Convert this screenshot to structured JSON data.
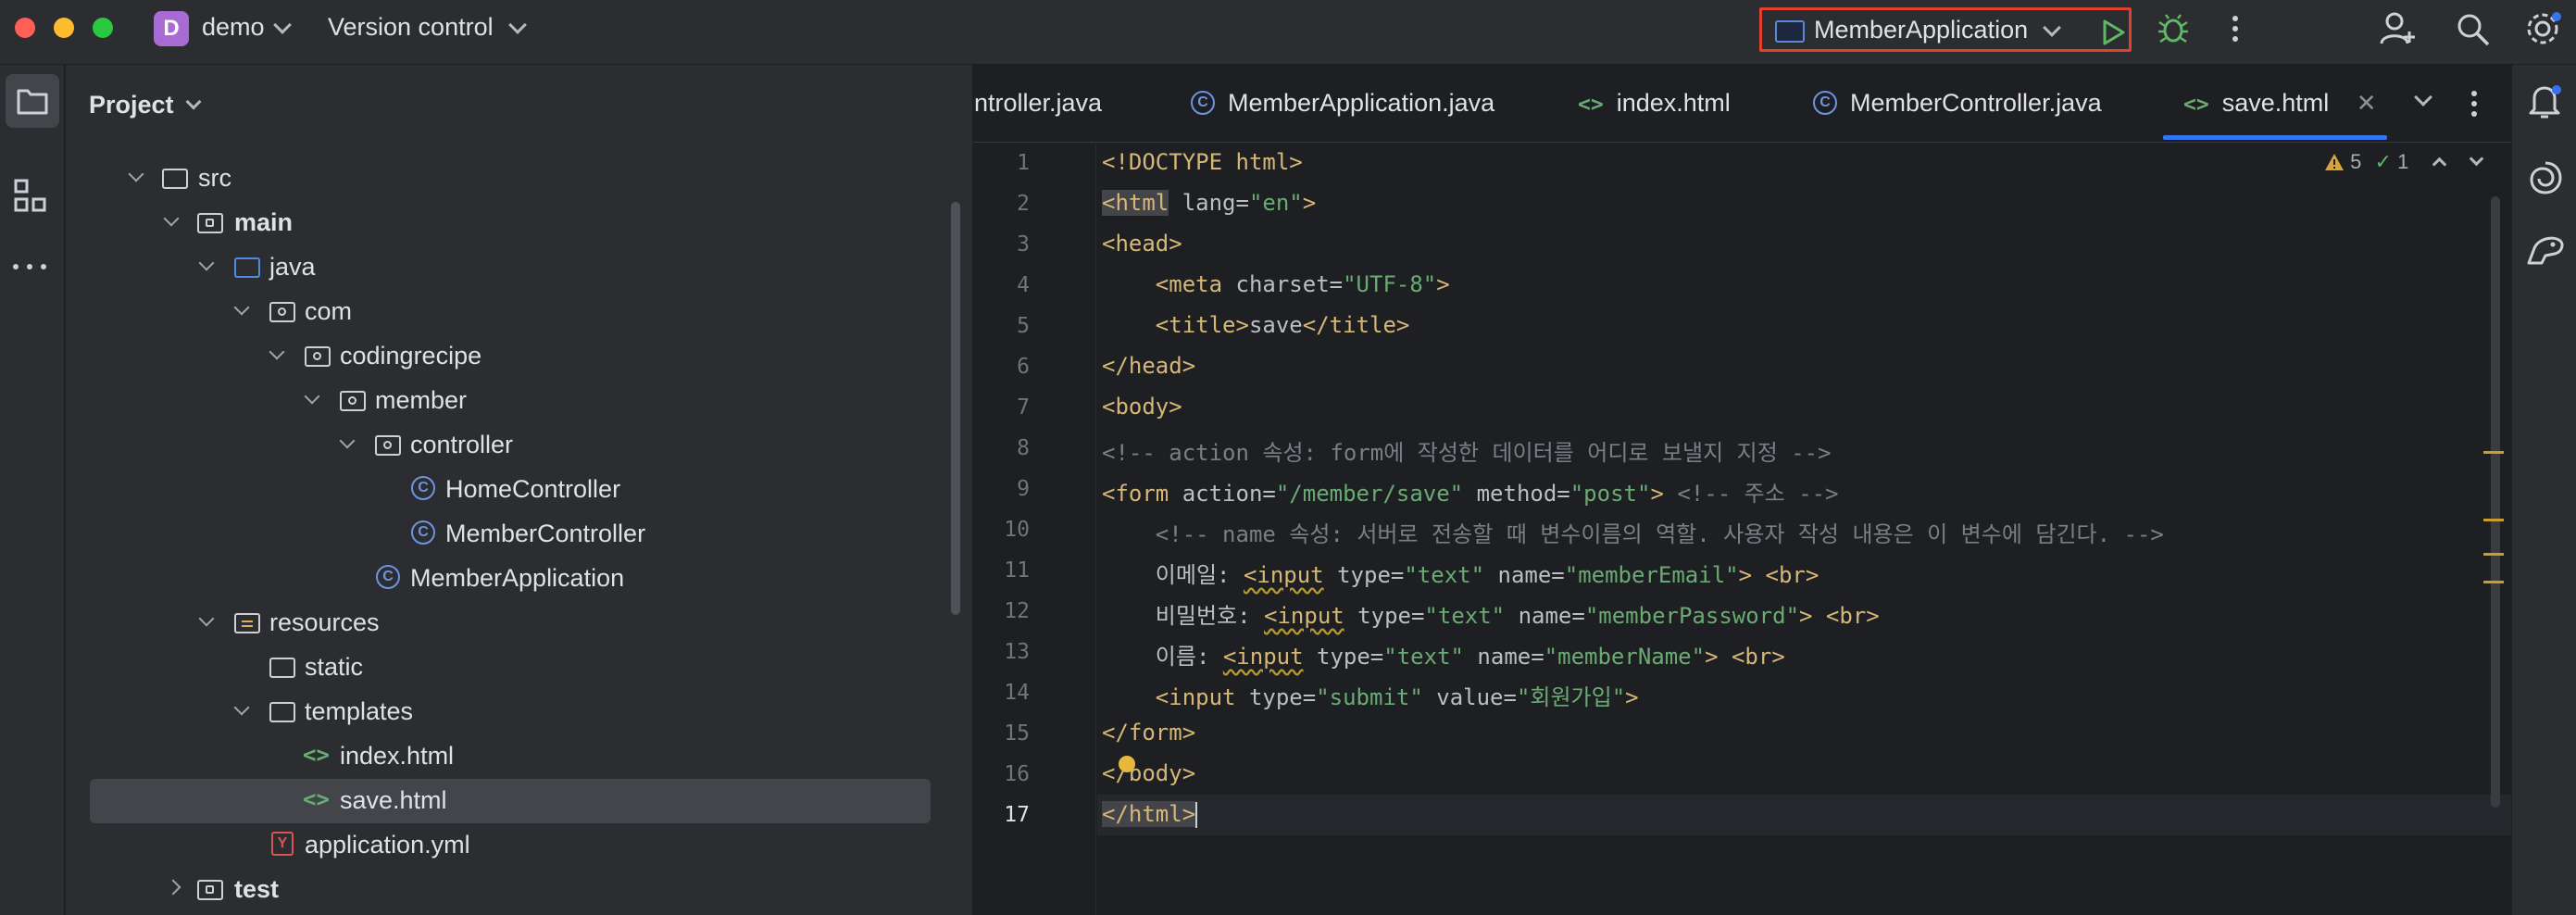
{
  "titlebar": {
    "project_initial": "D",
    "project_name": "demo",
    "vcs_label": "Version control",
    "run_config": "MemberApplication"
  },
  "project_panel": {
    "title": "Project",
    "tree": [
      {
        "label": "src",
        "kind": "folder"
      },
      {
        "label": "main",
        "kind": "source-folder"
      },
      {
        "label": "java",
        "kind": "java-folder"
      },
      {
        "label": "com",
        "kind": "package"
      },
      {
        "label": "codingrecipe",
        "kind": "package"
      },
      {
        "label": "member",
        "kind": "package"
      },
      {
        "label": "controller",
        "kind": "package"
      },
      {
        "label": "HomeController",
        "kind": "class"
      },
      {
        "label": "MemberController",
        "kind": "class"
      },
      {
        "label": "MemberApplication",
        "kind": "spring-class"
      },
      {
        "label": "resources",
        "kind": "resources-folder"
      },
      {
        "label": "static",
        "kind": "folder"
      },
      {
        "label": "templates",
        "kind": "folder"
      },
      {
        "label": "index.html",
        "kind": "html"
      },
      {
        "label": "save.html",
        "kind": "html",
        "selected": true
      },
      {
        "label": "application.yml",
        "kind": "yml"
      },
      {
        "label": "test",
        "kind": "source-folder"
      }
    ]
  },
  "tabs": [
    {
      "label": "ntroller.java"
    },
    {
      "label": "MemberApplication.java"
    },
    {
      "label": "index.html"
    },
    {
      "label": "MemberController.java"
    },
    {
      "label": "save.html",
      "active": true
    }
  ],
  "inspections": {
    "warnings": "5",
    "checks": "1"
  },
  "editor": {
    "line_numbers": [
      "1",
      "2",
      "3",
      "4",
      "5",
      "6",
      "7",
      "8",
      "9",
      "10",
      "11",
      "12",
      "13",
      "14",
      "15",
      "16",
      "17"
    ],
    "current_line": "17",
    "lines": {
      "l1": "<!DOCTYPE html>",
      "l2a": "<html",
      "l2b": " lang=",
      "l2c": "\"en\"",
      "l2d": ">",
      "l3": "<head>",
      "l4a": "    <meta",
      "l4b": " charset=",
      "l4c": "\"UTF-8\"",
      "l4d": ">",
      "l5a": "    <title>",
      "l5b": "save",
      "l5c": "</title>",
      "l6": "</head>",
      "l7": "<body>",
      "l8": "<!-- action 속성: form에 작성한 데이터를 어디로 보낼지 지정 -->",
      "l9a": "<form",
      "l9b": " action=",
      "l9c": "\"/member/save\"",
      "l9d": " method=",
      "l9e": "\"post\"",
      "l9f": ">",
      "l9g": " <!-- 주소 -->",
      "l10": "    <!-- name 속성: 서버로 전송할 때 변수이름의 역할. 사용자 작성 내용은 이 변수에 담긴다. -->",
      "l11a": "    이메일: ",
      "l11b": "<input",
      "l11c": " type=",
      "l11d": "\"text\"",
      "l11e": " name=",
      "l11f": "\"memberEmail\"",
      "l11g": ">",
      "l11h": " <br>",
      "l12a": "    비밀번호: ",
      "l12b": "<input",
      "l12c": " type=",
      "l12d": "\"text\"",
      "l12e": " name=",
      "l12f": "\"memberPassword\"",
      "l12g": ">",
      "l12h": " <br>",
      "l13a": "    이름: ",
      "l13b": "<input",
      "l13c": " type=",
      "l13d": "\"text\"",
      "l13e": " name=",
      "l13f": "\"memberName\"",
      "l13g": ">",
      "l13h": " <br>",
      "l14a": "    <input",
      "l14b": " type=",
      "l14c": "\"submit\"",
      "l14d": " value=",
      "l14e": "\"회원가입\"",
      "l14f": ">",
      "l15": "</form>",
      "l16": "</body>",
      "l17": "</html>"
    }
  }
}
